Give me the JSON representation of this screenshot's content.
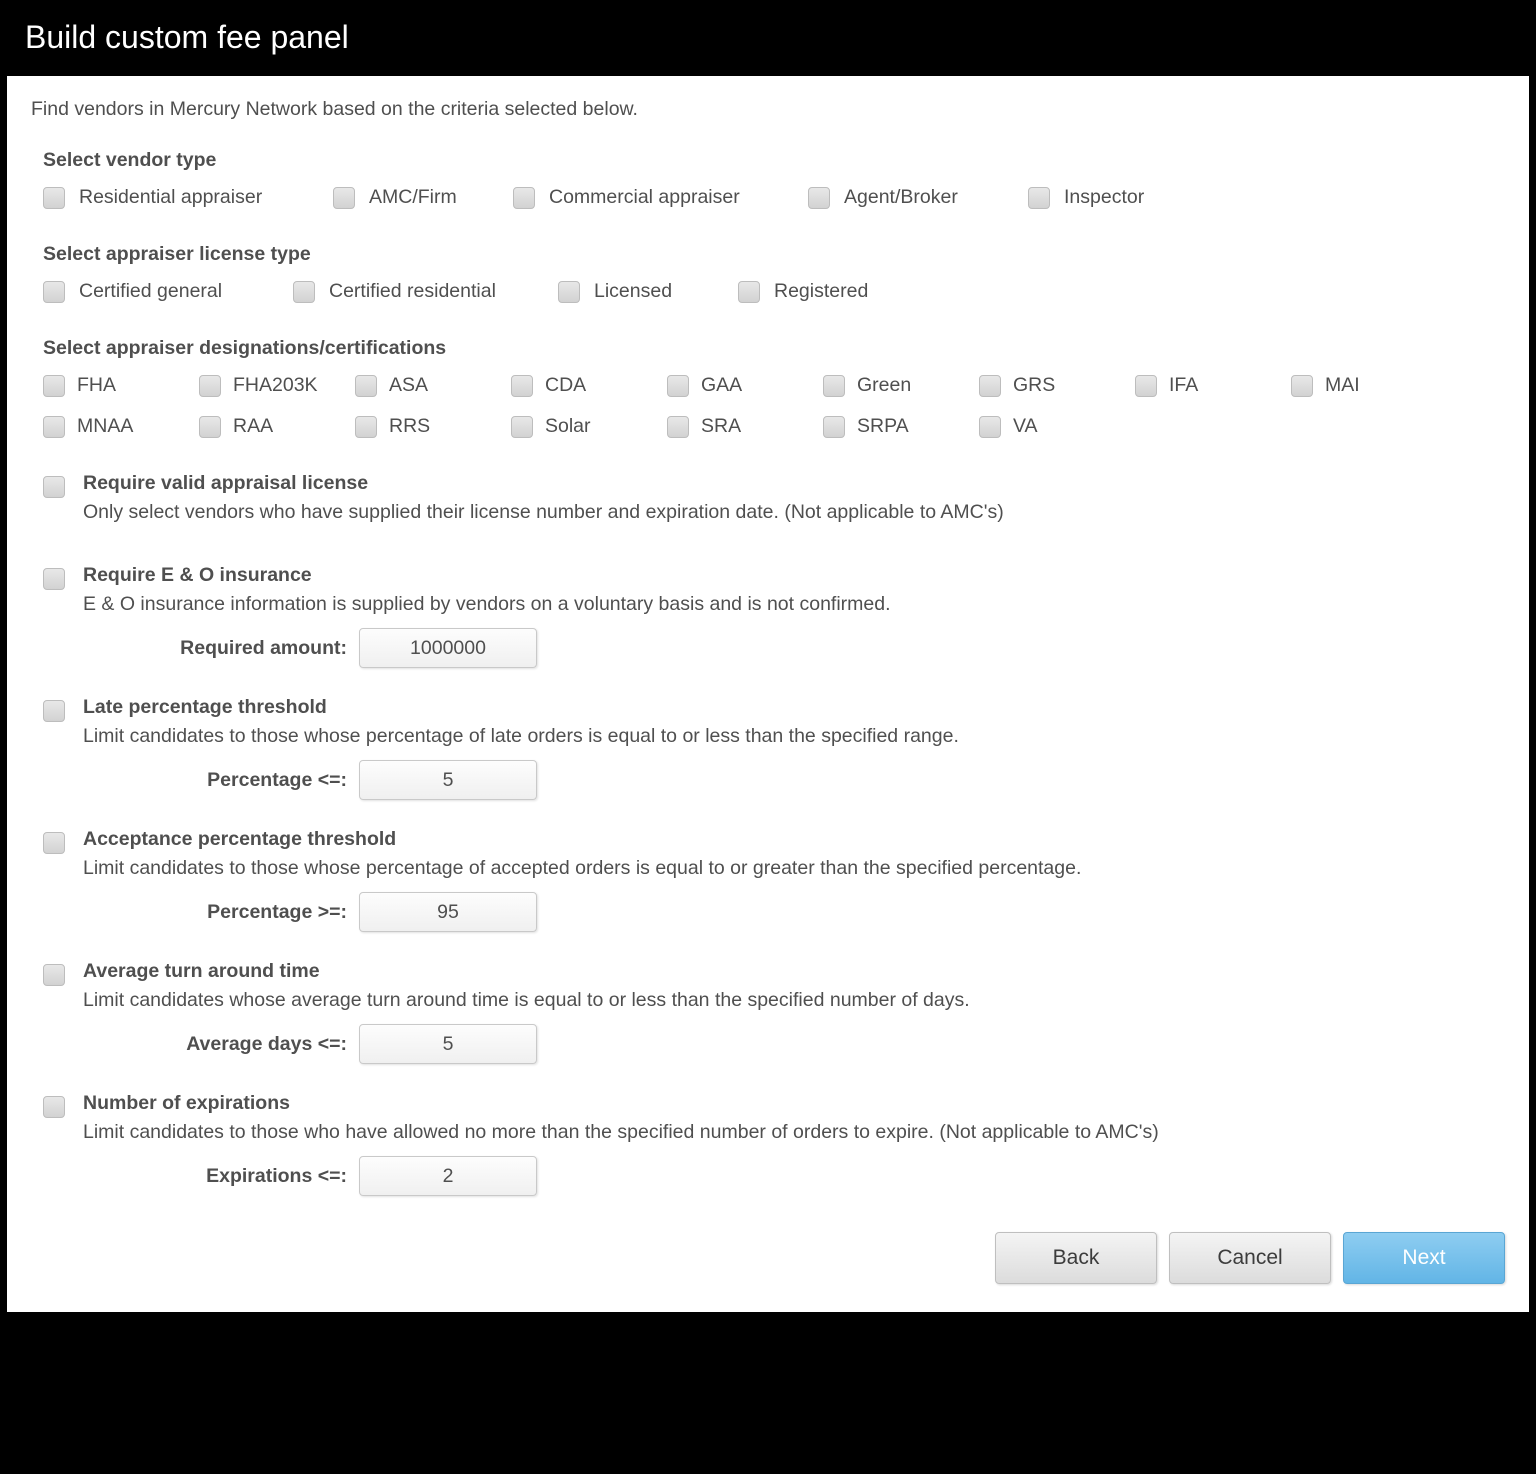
{
  "header": {
    "title": "Build custom fee panel"
  },
  "intro": "Find vendors in Mercury Network based on the criteria selected below.",
  "vendor_type": {
    "heading": "Select vendor type",
    "options": [
      "Residential appraiser",
      "AMC/Firm",
      "Commercial appraiser",
      "Agent/Broker",
      "Inspector"
    ]
  },
  "license_type": {
    "heading": "Select appraiser license type",
    "options": [
      "Certified general",
      "Certified residential",
      "Licensed",
      "Registered"
    ]
  },
  "designations": {
    "heading": "Select appraiser designations/certifications",
    "options": [
      "FHA",
      "FHA203K",
      "ASA",
      "CDA",
      "GAA",
      "Green",
      "GRS",
      "IFA",
      "MAI",
      "MNAA",
      "RAA",
      "RRS",
      "Solar",
      "SRA",
      "SRPA",
      "VA"
    ]
  },
  "req_license": {
    "title": "Require valid appraisal license",
    "desc": "Only select vendors who have supplied their license number and expiration date. (Not applicable to AMC's)"
  },
  "req_eo": {
    "title": "Require E & O insurance",
    "desc": "E & O insurance information is supplied by vendors on a voluntary basis and is not confirmed.",
    "field_label": "Required amount:",
    "value": "1000000"
  },
  "late_pct": {
    "title": "Late percentage threshold",
    "desc": "Limit candidates to those whose percentage of late orders is equal to or less than the specified range.",
    "field_label": "Percentage <=:",
    "value": "5"
  },
  "accept_pct": {
    "title": "Acceptance percentage threshold",
    "desc": "Limit candidates to those whose percentage of accepted orders is equal to or greater than the specified percentage.",
    "field_label": "Percentage >=:",
    "value": "95"
  },
  "avg_turn": {
    "title": "Average turn around time",
    "desc": "Limit candidates whose average turn around time is equal to or less than the specified number of days.",
    "field_label": "Average days <=:",
    "value": "5"
  },
  "expirations": {
    "title": "Number of expirations",
    "desc": "Limit candidates to those who have allowed no more than the specified number of orders to expire. (Not applicable to AMC's)",
    "field_label": "Expirations <=:",
    "value": "2"
  },
  "buttons": {
    "back": "Back",
    "cancel": "Cancel",
    "next": "Next"
  }
}
